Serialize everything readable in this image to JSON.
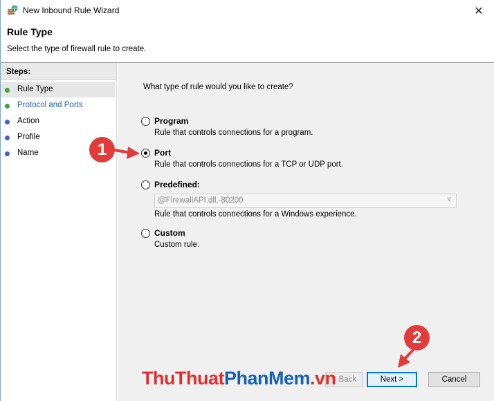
{
  "window": {
    "title": "New Inbound Rule Wizard",
    "close_glyph": "✕"
  },
  "header": {
    "title": "Rule Type",
    "subtitle": "Select the type of firewall rule to create."
  },
  "steps": {
    "heading": "Steps:",
    "items": [
      {
        "label": "Rule Type",
        "active": true,
        "dot_color": "#3aa63a"
      },
      {
        "label": "Protocol and Ports",
        "active": false,
        "dot_color": "#3aa63a"
      },
      {
        "label": "Action",
        "active": false,
        "dot_color": "#4a5fc8"
      },
      {
        "label": "Profile",
        "active": false,
        "dot_color": "#4a5fc8"
      },
      {
        "label": "Name",
        "active": false,
        "dot_color": "#4a5fc8"
      }
    ]
  },
  "main": {
    "question": "What type of rule would you like to create?",
    "options": [
      {
        "label": "Program",
        "description": "Rule that controls connections for a program.",
        "selected": false
      },
      {
        "label": "Port",
        "description": "Rule that controls connections for a TCP or UDP port.",
        "selected": true
      },
      {
        "label": "Predefined:",
        "description": "Rule that controls connections for a Windows experience.",
        "selected": false
      },
      {
        "label": "Custom",
        "description": "Custom rule.",
        "selected": false
      }
    ],
    "predefined_value": "@FirewallAPI.dll,-80200"
  },
  "buttons": {
    "back": "< Back",
    "next": "Next >",
    "cancel": "Cancel"
  },
  "annotations": {
    "badge1": "1",
    "badge2": "2",
    "color": "#e03c3c"
  },
  "watermark": {
    "part1": "ThuThuat",
    "part2": "PhanMem",
    "part3": ".vn"
  },
  "icons": {
    "app": "firewall-shield-icon",
    "close": "close-icon",
    "dropdown": "chevron-down-icon"
  }
}
